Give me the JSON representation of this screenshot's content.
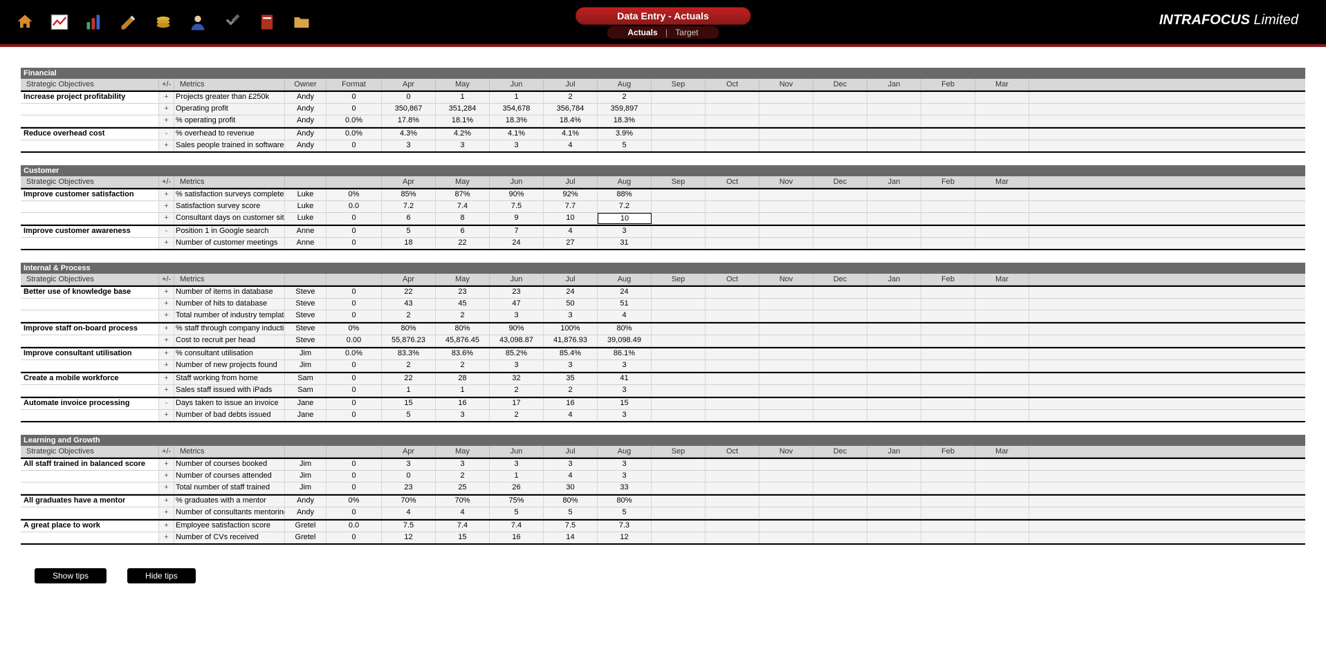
{
  "company": "INTRAFOCUS",
  "company_suffix": "Limited",
  "page_title": "Data Entry - Actuals",
  "subtabs": {
    "active": "Actuals",
    "other": "Target"
  },
  "months": [
    "Apr",
    "May",
    "Jun",
    "Jul",
    "Aug",
    "Sep",
    "Oct",
    "Nov",
    "Dec",
    "Jan",
    "Feb",
    "Mar"
  ],
  "hdr": {
    "obj": "Strategic Objectives",
    "pm": "+/-",
    "metrics": "Metrics",
    "owner": "Owner",
    "format": "Format"
  },
  "sections": [
    {
      "title": "Financial",
      "show_owner_hdr": true,
      "show_format_hdr": true,
      "rows": [
        {
          "obj": "Increase project profitability",
          "pm": "+",
          "metric": "Projects greater than £250k",
          "owner": "Andy",
          "fmt": "0",
          "v": [
            "0",
            "1",
            "1",
            "2",
            "2",
            "",
            "",
            "",
            "",
            "",
            "",
            ""
          ]
        },
        {
          "obj": "",
          "pm": "+",
          "metric": "Operating profit",
          "owner": "Andy",
          "fmt": "0",
          "v": [
            "350,867",
            "351,284",
            "354,678",
            "356,784",
            "359,897",
            "",
            "",
            "",
            "",
            "",
            "",
            ""
          ]
        },
        {
          "obj": "",
          "pm": "+",
          "metric": "% operating profit",
          "owner": "Andy",
          "fmt": "0.0%",
          "v": [
            "17.8%",
            "18.1%",
            "18.3%",
            "18.4%",
            "18.3%",
            "",
            "",
            "",
            "",
            "",
            "",
            ""
          ]
        },
        {
          "obj": "Reduce overhead cost",
          "pm": "-",
          "metric": "% overhead to revenue",
          "owner": "Andy",
          "fmt": "0.0%",
          "v": [
            "4.3%",
            "4.2%",
            "4.1%",
            "4.1%",
            "3.9%",
            "",
            "",
            "",
            "",
            "",
            "",
            ""
          ]
        },
        {
          "obj": "",
          "pm": "+",
          "metric": "Sales people trained in software",
          "owner": "Andy",
          "fmt": "0",
          "v": [
            "3",
            "3",
            "3",
            "4",
            "5",
            "",
            "",
            "",
            "",
            "",
            "",
            ""
          ]
        }
      ]
    },
    {
      "title": "Customer",
      "show_owner_hdr": false,
      "show_format_hdr": false,
      "rows": [
        {
          "obj": "Improve customer satisfaction",
          "pm": "+",
          "metric": "% satisfaction surveys complete",
          "owner": "Luke",
          "fmt": "0%",
          "v": [
            "85%",
            "87%",
            "90%",
            "92%",
            "88%",
            "",
            "",
            "",
            "",
            "",
            "",
            ""
          ]
        },
        {
          "obj": "",
          "pm": "+",
          "metric": "Satisfaction survey score",
          "owner": "Luke",
          "fmt": "0.0",
          "v": [
            "7.2",
            "7.4",
            "7.5",
            "7.7",
            "7.2",
            "",
            "",
            "",
            "",
            "",
            "",
            ""
          ]
        },
        {
          "obj": "",
          "pm": "+",
          "metric": "Consultant days on customer site",
          "owner": "Luke",
          "fmt": "0",
          "v": [
            "6",
            "8",
            "9",
            "10",
            "10",
            "",
            "",
            "",
            "",
            "",
            "",
            ""
          ],
          "selected": 4
        },
        {
          "obj": "Improve customer awareness",
          "pm": "-",
          "metric": "Position 1 in Google search",
          "owner": "Anne",
          "fmt": "0",
          "v": [
            "5",
            "6",
            "7",
            "4",
            "3",
            "",
            "",
            "",
            "",
            "",
            "",
            ""
          ]
        },
        {
          "obj": "",
          "pm": "+",
          "metric": "Number of customer meetings",
          "owner": "Anne",
          "fmt": "0",
          "v": [
            "18",
            "22",
            "24",
            "27",
            "31",
            "",
            "",
            "",
            "",
            "",
            "",
            ""
          ]
        }
      ]
    },
    {
      "title": "Internal & Process",
      "show_owner_hdr": false,
      "show_format_hdr": false,
      "rows": [
        {
          "obj": "Better use of knowledge base",
          "pm": "+",
          "metric": "Number of items in database",
          "owner": "Steve",
          "fmt": "0",
          "v": [
            "22",
            "23",
            "23",
            "24",
            "24",
            "",
            "",
            "",
            "",
            "",
            "",
            ""
          ]
        },
        {
          "obj": "",
          "pm": "+",
          "metric": "Number of hits to database",
          "owner": "Steve",
          "fmt": "0",
          "v": [
            "43",
            "45",
            "47",
            "50",
            "51",
            "",
            "",
            "",
            "",
            "",
            "",
            ""
          ]
        },
        {
          "obj": "",
          "pm": "+",
          "metric": "Total number of industry template",
          "owner": "Steve",
          "fmt": "0",
          "v": [
            "2",
            "2",
            "3",
            "3",
            "4",
            "",
            "",
            "",
            "",
            "",
            "",
            ""
          ]
        },
        {
          "obj": "Improve staff on-board process",
          "pm": "+",
          "metric": "% staff through company inductio",
          "owner": "Steve",
          "fmt": "0%",
          "v": [
            "80%",
            "80%",
            "90%",
            "100%",
            "80%",
            "",
            "",
            "",
            "",
            "",
            "",
            ""
          ]
        },
        {
          "obj": "",
          "pm": "+",
          "metric": "Cost to recruit per head",
          "owner": "Steve",
          "fmt": "0.00",
          "v": [
            "55,876.23",
            "45,876.45",
            "43,098.87",
            "41,876.93",
            "39,098.49",
            "",
            "",
            "",
            "",
            "",
            "",
            ""
          ]
        },
        {
          "obj": "Improve consultant utilisation",
          "pm": "+",
          "metric": "% consultant utilisation",
          "owner": "Jim",
          "fmt": "0.0%",
          "v": [
            "83.3%",
            "83.6%",
            "85.2%",
            "85.4%",
            "86.1%",
            "",
            "",
            "",
            "",
            "",
            "",
            ""
          ]
        },
        {
          "obj": "",
          "pm": "+",
          "metric": "Number of new projects found",
          "owner": "Jim",
          "fmt": "0",
          "v": [
            "2",
            "2",
            "3",
            "3",
            "3",
            "",
            "",
            "",
            "",
            "",
            "",
            ""
          ]
        },
        {
          "obj": "Create a mobile workforce",
          "pm": "+",
          "metric": "Staff working from home",
          "owner": "Sam",
          "fmt": "0",
          "v": [
            "22",
            "28",
            "32",
            "35",
            "41",
            "",
            "",
            "",
            "",
            "",
            "",
            ""
          ]
        },
        {
          "obj": "",
          "pm": "+",
          "metric": "Sales staff issued with iPads",
          "owner": "Sam",
          "fmt": "0",
          "v": [
            "1",
            "1",
            "2",
            "2",
            "3",
            "",
            "",
            "",
            "",
            "",
            "",
            ""
          ]
        },
        {
          "obj": "Automate invoice processing",
          "pm": "-",
          "metric": "Days taken to issue an invoice",
          "owner": "Jane",
          "fmt": "0",
          "v": [
            "15",
            "16",
            "17",
            "16",
            "15",
            "",
            "",
            "",
            "",
            "",
            "",
            ""
          ]
        },
        {
          "obj": "",
          "pm": "+",
          "metric": "Number of bad debts issued",
          "owner": "Jane",
          "fmt": "0",
          "v": [
            "5",
            "3",
            "2",
            "4",
            "3",
            "",
            "",
            "",
            "",
            "",
            "",
            ""
          ]
        }
      ]
    },
    {
      "title": "Learning and Growth",
      "show_owner_hdr": false,
      "show_format_hdr": false,
      "rows": [
        {
          "obj": "All staff trained in balanced score",
          "pm": "+",
          "metric": "Number of courses booked",
          "owner": "Jim",
          "fmt": "0",
          "v": [
            "3",
            "3",
            "3",
            "3",
            "3",
            "",
            "",
            "",
            "",
            "",
            "",
            ""
          ]
        },
        {
          "obj": "",
          "pm": "+",
          "metric": "Number of courses attended",
          "owner": "Jim",
          "fmt": "0",
          "v": [
            "0",
            "2",
            "1",
            "4",
            "3",
            "",
            "",
            "",
            "",
            "",
            "",
            ""
          ]
        },
        {
          "obj": "",
          "pm": "+",
          "metric": "Total number of staff trained",
          "owner": "Jim",
          "fmt": "0",
          "v": [
            "23",
            "25",
            "26",
            "30",
            "33",
            "",
            "",
            "",
            "",
            "",
            "",
            ""
          ]
        },
        {
          "obj": "All graduates have a mentor",
          "pm": "+",
          "metric": "% graduates with a mentor",
          "owner": "Andy",
          "fmt": "0%",
          "v": [
            "70%",
            "70%",
            "75%",
            "80%",
            "80%",
            "",
            "",
            "",
            "",
            "",
            "",
            ""
          ]
        },
        {
          "obj": "",
          "pm": "+",
          "metric": "Number of consultants mentoring",
          "owner": "Andy",
          "fmt": "0",
          "v": [
            "4",
            "4",
            "5",
            "5",
            "5",
            "",
            "",
            "",
            "",
            "",
            "",
            ""
          ]
        },
        {
          "obj": "A great place to work",
          "pm": "+",
          "metric": "Employee satisfaction score",
          "owner": "Gretel",
          "fmt": "0.0",
          "v": [
            "7.5",
            "7.4",
            "7.4",
            "7.5",
            "7.3",
            "",
            "",
            "",
            "",
            "",
            "",
            ""
          ]
        },
        {
          "obj": "",
          "pm": "+",
          "metric": "Number of CVs received",
          "owner": "Gretel",
          "fmt": "0",
          "v": [
            "12",
            "15",
            "16",
            "14",
            "12",
            "",
            "",
            "",
            "",
            "",
            "",
            ""
          ]
        }
      ]
    }
  ],
  "buttons": {
    "show": "Show tips",
    "hide": "Hide tips"
  }
}
